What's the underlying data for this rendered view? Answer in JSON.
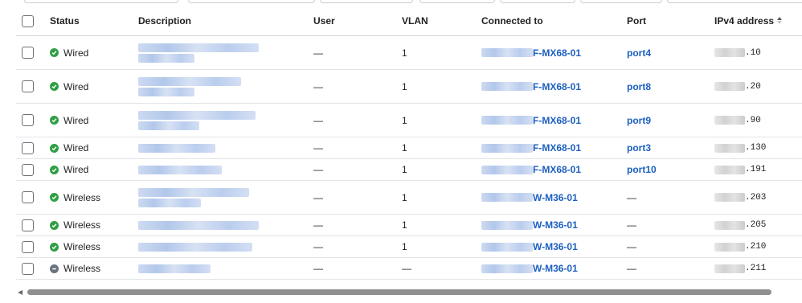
{
  "columns": {
    "status": "Status",
    "description": "Description",
    "user": "User",
    "vlan": "VLAN",
    "connected_to": "Connected to",
    "port": "Port",
    "ipv4": "IPv4 address"
  },
  "colors": {
    "online": "#2f9e44",
    "offline": "#6b7280",
    "link": "#1b5fc0"
  },
  "rows": [
    {
      "status": "Wired",
      "status_state": "online",
      "desc_lines": 2,
      "user": "—",
      "vlan": "1",
      "connected_to": "F-MX68-01",
      "port": "port4",
      "ip_suffix": ".10"
    },
    {
      "status": "Wired",
      "status_state": "online",
      "desc_lines": 2,
      "user": "—",
      "vlan": "1",
      "connected_to": "F-MX68-01",
      "port": "port8",
      "ip_suffix": ".20"
    },
    {
      "status": "Wired",
      "status_state": "online",
      "desc_lines": 2,
      "user": "—",
      "vlan": "1",
      "connected_to": "F-MX68-01",
      "port": "port9",
      "ip_suffix": ".90"
    },
    {
      "status": "Wired",
      "status_state": "online",
      "desc_lines": 1,
      "user": "—",
      "vlan": "1",
      "connected_to": "F-MX68-01",
      "port": "port3",
      "ip_suffix": ".130"
    },
    {
      "status": "Wired",
      "status_state": "online",
      "desc_lines": 1,
      "user": "—",
      "vlan": "1",
      "connected_to": "F-MX68-01",
      "port": "port10",
      "ip_suffix": ".191"
    },
    {
      "status": "Wireless",
      "status_state": "online",
      "desc_lines": 2,
      "user": "—",
      "vlan": "1",
      "connected_to": "W-M36-01",
      "port": "—",
      "ip_suffix": ".203"
    },
    {
      "status": "Wireless",
      "status_state": "online",
      "desc_lines": 1,
      "user": "—",
      "vlan": "1",
      "connected_to": "W-M36-01",
      "port": "—",
      "ip_suffix": ".205"
    },
    {
      "status": "Wireless",
      "status_state": "online",
      "desc_lines": 1,
      "user": "—",
      "vlan": "1",
      "connected_to": "W-M36-01",
      "port": "—",
      "ip_suffix": ".210"
    },
    {
      "status": "Wireless",
      "status_state": "offline",
      "desc_lines": 1,
      "user": "—",
      "vlan": "—",
      "connected_to": "W-M36-01",
      "port": "—",
      "ip_suffix": ".211"
    }
  ]
}
